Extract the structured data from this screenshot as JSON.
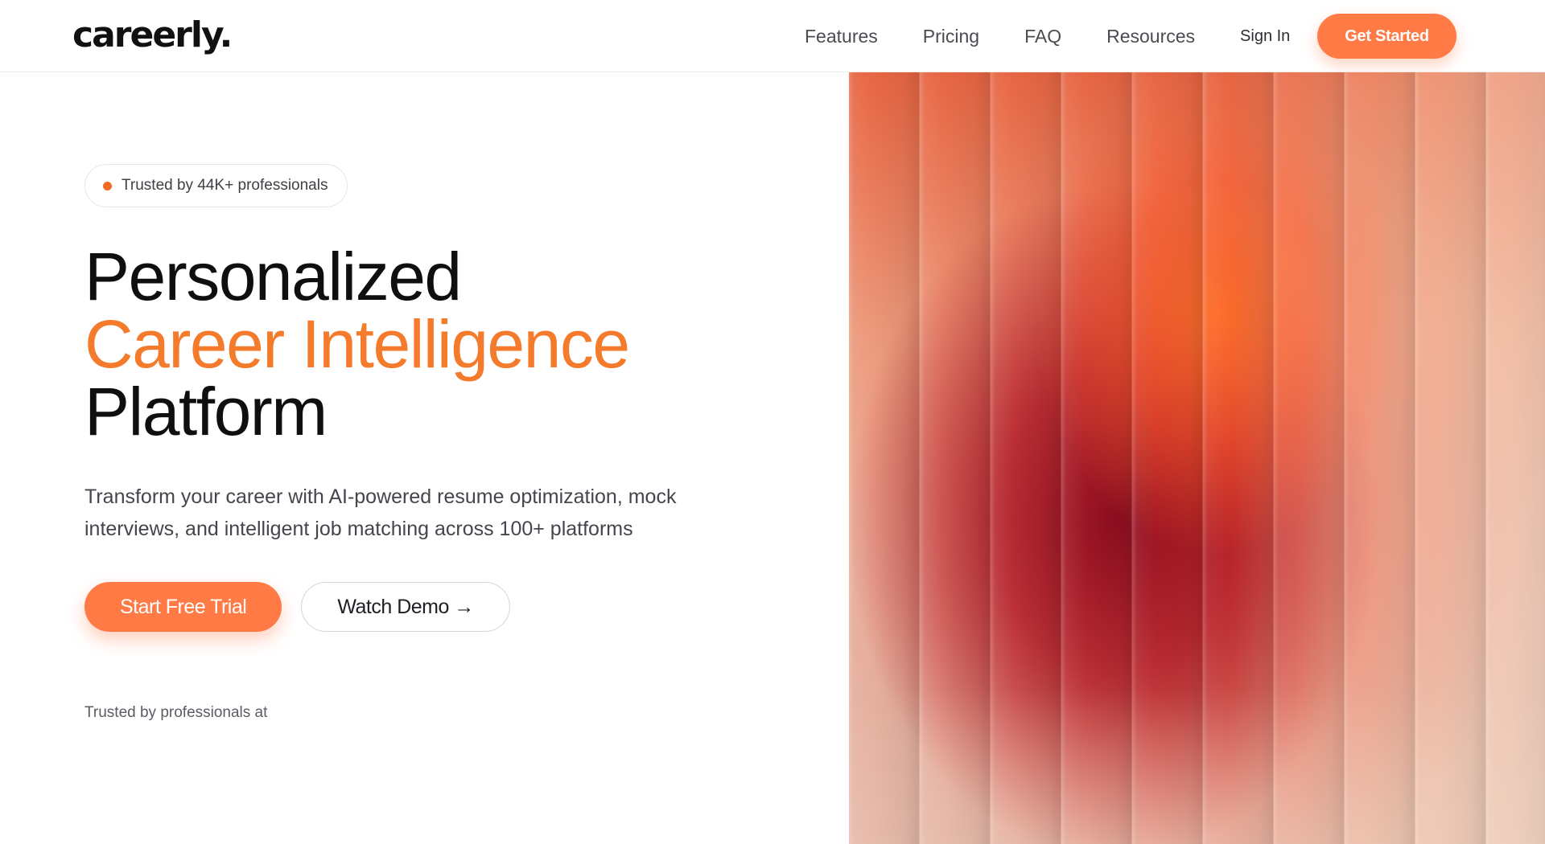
{
  "brand": {
    "logo_text": "careerly.",
    "accent_color": "#ff7a45"
  },
  "nav": {
    "links": [
      {
        "label": "Features"
      },
      {
        "label": "Pricing"
      },
      {
        "label": "FAQ"
      },
      {
        "label": "Resources"
      }
    ],
    "signin_label": "Sign In",
    "cta_label": "Get Started"
  },
  "hero": {
    "badge_text": "Trusted by 44K+ professionals",
    "headline_line1": "Personalized",
    "headline_line2": "Career Intelligence",
    "headline_line3": "Platform",
    "subtitle": "Transform your career with AI-powered resume optimization, mock interviews, and intelligent job matching across 100+ platforms",
    "primary_cta": "Start Free Trial",
    "secondary_cta": "Watch Demo →",
    "trusted_at": "Trusted by professionals at"
  }
}
